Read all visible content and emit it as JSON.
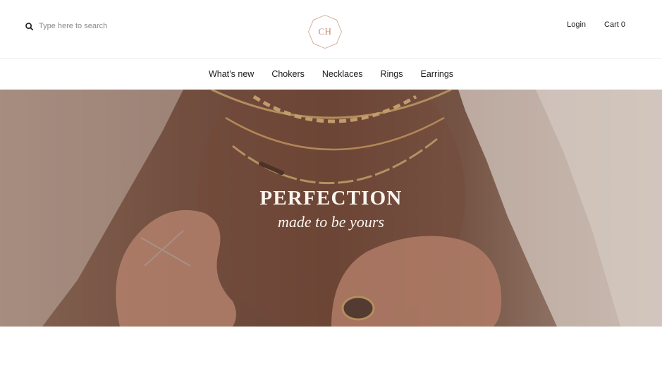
{
  "header": {
    "search": {
      "placeholder": "Type here to search",
      "icon": "search-icon"
    },
    "logo": {
      "text": "CH",
      "color": "#c9876e"
    },
    "account": {
      "login_label": "Login",
      "cart_label": "Cart",
      "cart_count": "0"
    }
  },
  "nav": {
    "items": [
      {
        "label": "What’s new"
      },
      {
        "label": "Chokers"
      },
      {
        "label": "Necklaces"
      },
      {
        "label": "Rings"
      },
      {
        "label": "Earrings"
      }
    ]
  },
  "hero": {
    "title": "PERFECTION",
    "subtitle": "made to be yours",
    "text_color": "#fbf5ef",
    "background_color": "#6a4536"
  }
}
